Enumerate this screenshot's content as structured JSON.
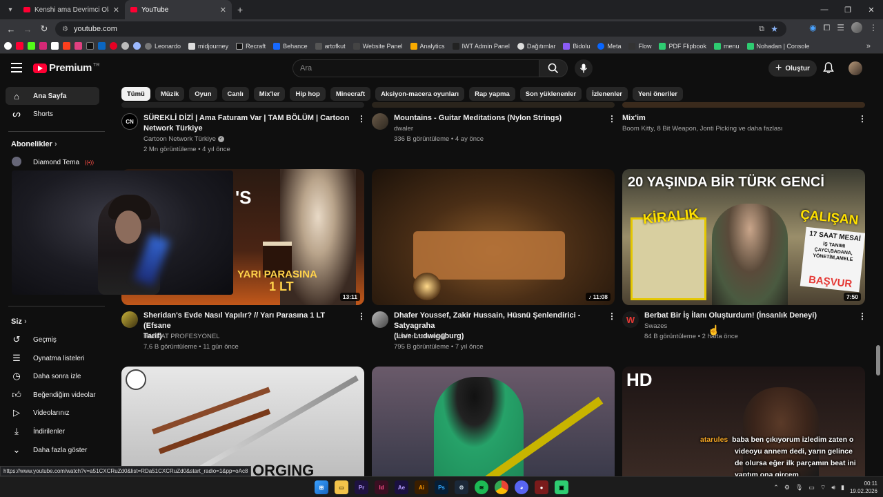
{
  "browser": {
    "tabs": [
      {
        "title": "Kenshi ama Devrimci Olarak - Y",
        "active": false
      },
      {
        "title": "YouTube",
        "active": true
      }
    ],
    "url": "youtube.com",
    "bookmarks": [
      "Leonardo",
      "midjourney",
      "Recraft",
      "Behance",
      "artofkut",
      "Website Panel",
      "Analytics",
      "IWT Admin Panel",
      "Dağıtımlar",
      "Bidolu",
      "Meta",
      "Flow",
      "PDF Flipbook",
      "menu",
      "Nohadan | Console"
    ],
    "status_url": "https://www.youtube.com/watch?v=a51CXCRuZd0&list=RDa51CXCRuZd0&start_radio=1&pp=oAc8"
  },
  "header": {
    "logo": "Premium",
    "logo_region": "TR",
    "search_placeholder": "Ara",
    "create_label": "Oluştur"
  },
  "chips": [
    "Tümü",
    "Müzik",
    "Oyun",
    "Canlı",
    "Mix'ler",
    "Hip hop",
    "Minecraft",
    "Aksiyon-macera oyunları",
    "Rap yapma",
    "Son yüklenenler",
    "İzlenenler",
    "Yeni öneriler"
  ],
  "sidebar": {
    "home": "Ana Sayfa",
    "shorts": "Shorts",
    "subs_head": "Abonelikler",
    "sub1": "Diamond Tema",
    "you_head": "Siz",
    "items": [
      "Geçmiş",
      "Oynatma listeleri",
      "Daha sonra izle",
      "Beğendiğim videolar",
      "Videolarınız",
      "İndirilenler",
      "Daha fazla göster"
    ]
  },
  "videos": [
    {
      "title1": "SÜREKLİ DİZİ | Ama Faturam Var | TAM BÖLÜM | Cartoon",
      "title2": "Network Türkiye",
      "channel": "Cartoon Network Türkiye",
      "meta": "2 Mn görüntüleme • 4 yıl önce"
    },
    {
      "title1": "Mountains - Guitar Meditations (Nylon Strings)",
      "title2": "",
      "channel": "dwaler",
      "meta": "336 B görüntüleme • 4 ay önce"
    },
    {
      "title1": "Mix'im",
      "title2": "",
      "channel": "Boom Kitty, 8 Bit Weapon, Jonti Picking ve daha fazlası",
      "meta": ""
    },
    {
      "title1": "Sheridan's Evde Nasıl Yapılır? //  Yarı Parasına 1 LT (Efsane",
      "title2": "Tarif)",
      "channel": "HAZKAT PROFESYONEL",
      "meta": "7,6 B görüntüleme • 11 gün önce",
      "duration": "13:11",
      "thumb_text1": "'S",
      "thumb_text2": "YARI PARASINA",
      "thumb_text3": "1 LT"
    },
    {
      "title1": "Dhafer Youssef, Zakir Hussain, Hüsnü Şenlendirici - Satyagraha",
      "title2": "(Live Ludwigsburg)",
      "channel": "Dhafer Youssef",
      "meta": "795 B görüntüleme • 7 yıl önce",
      "duration": "11:08"
    },
    {
      "title1": "Berbat Bir İş İlanı Oluşturdum! (İnsanlık Deneyi)",
      "title2": "",
      "channel": "Swazes",
      "meta": "84 B görüntüleme • 2 hafta önce",
      "duration": "7:50",
      "thumb_text1": "20 YAŞINDA BİR TÜRK GENCİ",
      "thumb_text2": "KİRALIK",
      "thumb_text3": "ÇALIŞAN",
      "thumb_text4": "17 SAAT MESAİ",
      "thumb_text5": "İŞ TANIMI ÇAYCI,BADANA, YÖNETİM,AMELE",
      "thumb_text6": "BAŞVUR"
    },
    {
      "thumb_text1": "ORGING"
    },
    {
      "thumb_text1": ""
    },
    {
      "thumb_text1": "HD"
    }
  ],
  "chat": {
    "user": "atarules",
    "lines": [
      "baba ben çıkıyorum izledim zaten o",
      "videoyu annem dedi, yarın gelince",
      "de olursa eğer ilk parçamın beat ini",
      "yaptım ona gircem"
    ]
  },
  "taskbar": {
    "time": "00:11",
    "date": "19.02.2026"
  },
  "colors": {
    "accent": "#ff0033",
    "background": "#0f0f0f"
  }
}
